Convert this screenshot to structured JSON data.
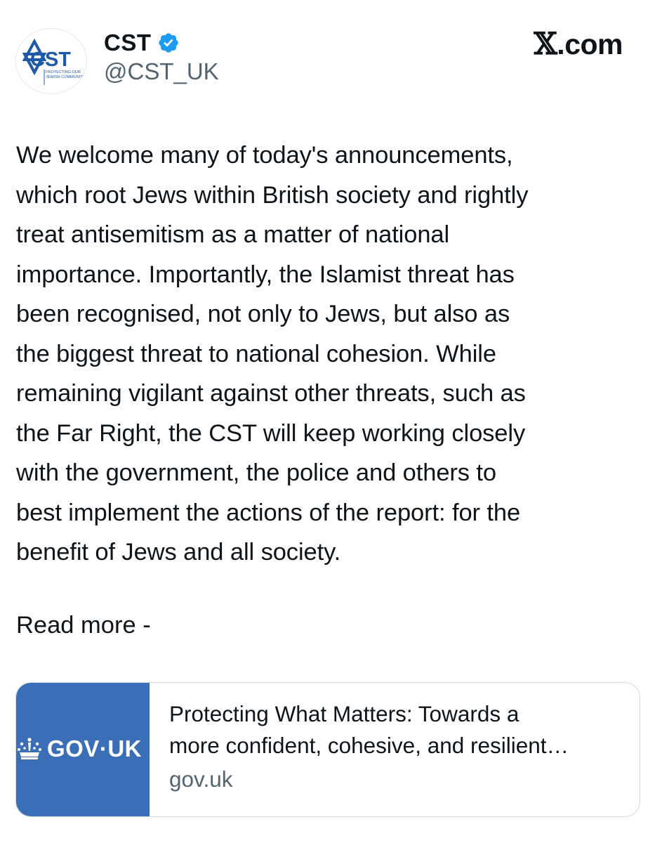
{
  "author": {
    "display_name": "CST",
    "handle": "@CST_UK",
    "avatar_logo_text": "CST",
    "avatar_tagline": [
      "PROTECTING OUR",
      "JEWISH COMMUNITY"
    ],
    "brand_color": "#1e5aa8",
    "verified_color": "#1d9bf0"
  },
  "source": {
    "x_glyph": "𝕏",
    "suffix": ".com"
  },
  "tweet": {
    "lines": [
      "We welcome many of today's announcements,",
      "which root Jews within British society and rightly",
      "treat antisemitism as a matter of national",
      "importance. Importantly, the Islamist threat has",
      "been recognised, not only to Jews, but also as",
      "the biggest threat to national cohesion. While",
      "remaining vigilant against other threats, such as",
      "the Far Right, the CST will keep working closely",
      "with the government, the police and others to",
      "best implement the actions of the report: for the",
      "benefit of Jews and all society."
    ],
    "read_more": "Read more -"
  },
  "link_card": {
    "logo_text": "GOV·UK",
    "thumb_color": "#3a6fb8",
    "title_lines": [
      "Protecting What Matters: Towards a",
      "more confident, cohesive, and resilient…"
    ],
    "domain": "gov.uk"
  }
}
